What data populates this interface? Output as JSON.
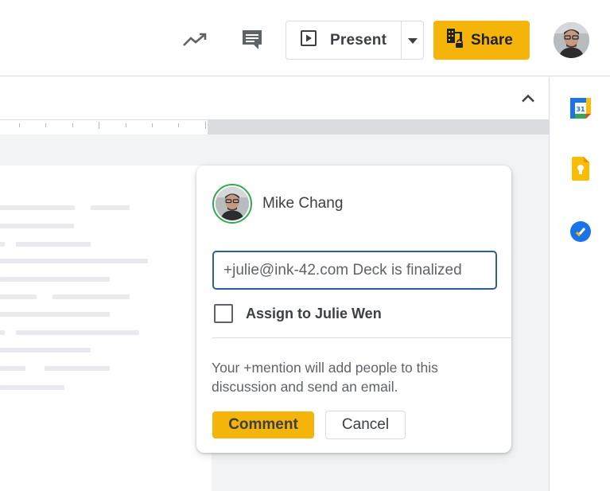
{
  "toolbar": {
    "present_label": "Present",
    "share_label": "Share",
    "icons": {
      "trend": "trending-up-icon",
      "comments": "comment-icon",
      "present": "slideshow-icon",
      "present_menu": "arrow-drop-down-icon",
      "share": "building-lock-icon"
    },
    "share_color": "#f5b40a"
  },
  "side_panel": {
    "apps": [
      {
        "name": "Calendar",
        "icon": "calendar-icon",
        "badge": "31"
      },
      {
        "name": "Keep",
        "icon": "keep-icon"
      },
      {
        "name": "Tasks",
        "icon": "tasks-icon"
      }
    ]
  },
  "comment_card": {
    "author": "Mike Chang",
    "input_value": "+julie@ink-42.com Deck is finalized",
    "assign_label": "Assign to Julie Wen",
    "assign_checked": false,
    "hint": "Your +mention will add people to this discussion and send an email.",
    "comment_button": "Comment",
    "cancel_button": "Cancel",
    "accent_color": "#2f5d9c"
  }
}
